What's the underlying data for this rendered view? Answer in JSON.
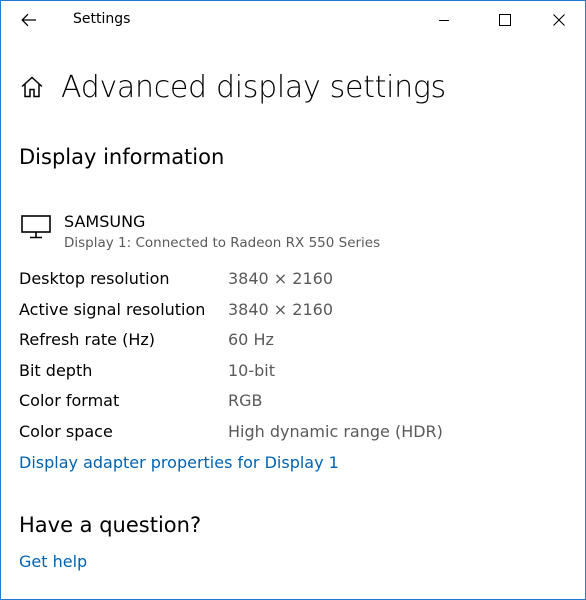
{
  "window": {
    "title": "Settings",
    "border_color": "#1e7ad7"
  },
  "titlebar": {
    "back_icon": "back-arrow-icon",
    "minimize_icon": "minimize-icon",
    "maximize_icon": "maximize-icon",
    "close_icon": "close-icon"
  },
  "header": {
    "home_icon": "home-icon",
    "title": "Advanced display settings"
  },
  "display_info": {
    "section_title": "Display information",
    "monitor": {
      "icon": "monitor-icon",
      "name": "SAMSUNG",
      "description": "Display 1: Connected to Radeon RX 550 Series"
    },
    "rows": [
      {
        "label": "Desktop resolution",
        "value": "3840 × 2160"
      },
      {
        "label": "Active signal resolution",
        "value": "3840 × 2160"
      },
      {
        "label": "Refresh rate (Hz)",
        "value": "60 Hz"
      },
      {
        "label": "Bit depth",
        "value": "10-bit"
      },
      {
        "label": "Color format",
        "value": "RGB"
      },
      {
        "label": "Color space",
        "value": "High dynamic range (HDR)"
      }
    ],
    "adapter_link": "Display adapter properties for Display 1"
  },
  "question": {
    "section_title": "Have a question?",
    "help_link": "Get help"
  },
  "colors": {
    "link": "#0063b1",
    "secondary_text": "#5a5a5a"
  }
}
